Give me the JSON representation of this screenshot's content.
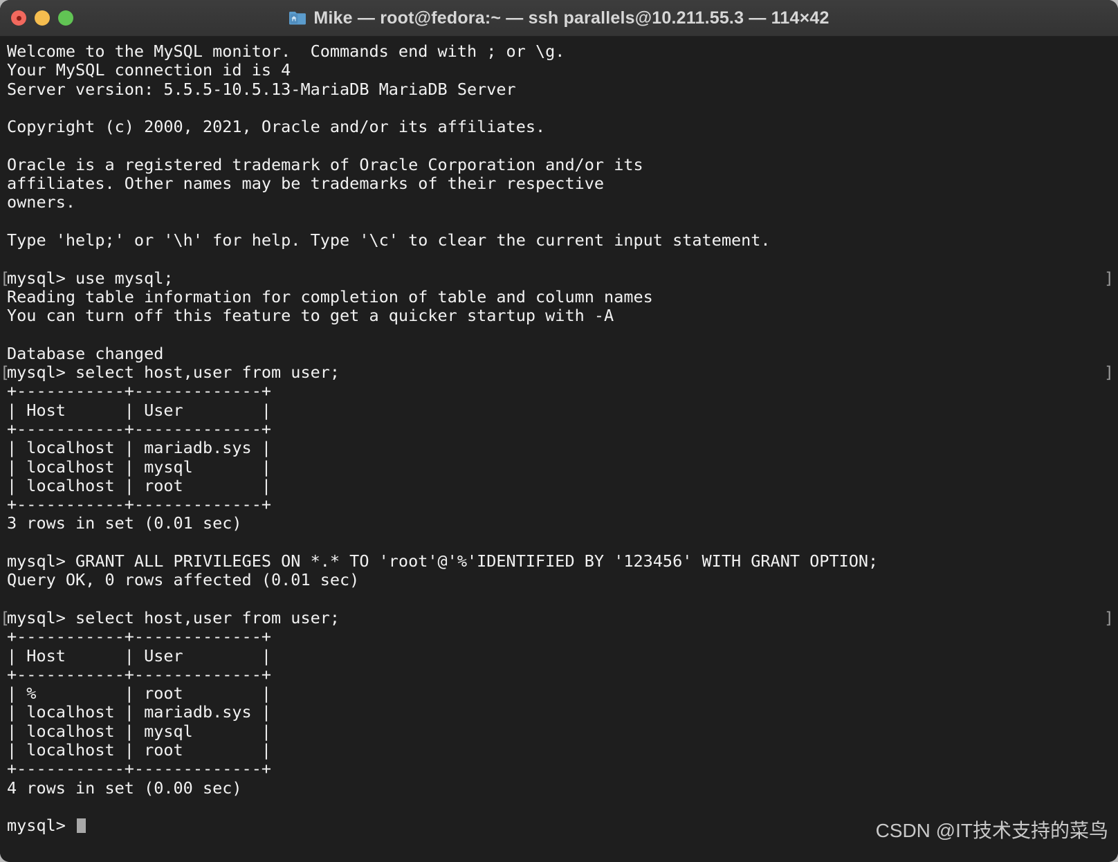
{
  "window": {
    "title": "Mike — root@fedora:~ — ssh parallels@10.211.55.3 — 114×42",
    "icon": "home-folder-icon",
    "titlebar_bg": "#383838",
    "terminal_bg": "#1e1e1e",
    "text_color": "#f2f2f2",
    "traffic_lights": [
      {
        "name": "close",
        "color": "#f2695e",
        "label": "Close"
      },
      {
        "name": "minimize",
        "color": "#f5bd4f",
        "label": "Minimize"
      },
      {
        "name": "zoom",
        "color": "#61c454",
        "label": "Zoom"
      }
    ]
  },
  "terminal": {
    "prompt": "mysql> ",
    "cursor": "block",
    "lines": [
      {
        "text": "Welcome to the MySQL monitor.  Commands end with ; or \\g."
      },
      {
        "text": "Your MySQL connection id is 4"
      },
      {
        "text": "Server version: 5.5.5-10.5.13-MariaDB MariaDB Server"
      },
      {
        "text": ""
      },
      {
        "text": "Copyright (c) 2000, 2021, Oracle and/or its affiliates."
      },
      {
        "text": ""
      },
      {
        "text": "Oracle is a registered trademark of Oracle Corporation and/or its"
      },
      {
        "text": "affiliates. Other names may be trademarks of their respective"
      },
      {
        "text": "owners."
      },
      {
        "text": ""
      },
      {
        "text": "Type 'help;' or '\\h' for help. Type '\\c' to clear the current input statement."
      },
      {
        "text": ""
      },
      {
        "text": "mysql> use mysql;",
        "mark_left": "[",
        "mark_right": "]"
      },
      {
        "text": "Reading table information for completion of table and column names"
      },
      {
        "text": "You can turn off this feature to get a quicker startup with -A"
      },
      {
        "text": ""
      },
      {
        "text": "Database changed"
      },
      {
        "text": "mysql> select host,user from user;",
        "mark_left": "[",
        "mark_right": "]"
      },
      {
        "text": "+-----------+-------------+"
      },
      {
        "text": "| Host      | User        |"
      },
      {
        "text": "+-----------+-------------+"
      },
      {
        "text": "| localhost | mariadb.sys |"
      },
      {
        "text": "| localhost | mysql       |"
      },
      {
        "text": "| localhost | root        |"
      },
      {
        "text": "+-----------+-------------+"
      },
      {
        "text": "3 rows in set (0.01 sec)"
      },
      {
        "text": ""
      },
      {
        "text": "mysql> GRANT ALL PRIVILEGES ON *.* TO 'root'@'%'IDENTIFIED BY '123456' WITH GRANT OPTION;"
      },
      {
        "text": "Query OK, 0 rows affected (0.01 sec)"
      },
      {
        "text": ""
      },
      {
        "text": "mysql> select host,user from user;",
        "mark_left": "[",
        "mark_right": "]"
      },
      {
        "text": "+-----------+-------------+"
      },
      {
        "text": "| Host      | User        |"
      },
      {
        "text": "+-----------+-------------+"
      },
      {
        "text": "| %         | root        |"
      },
      {
        "text": "| localhost | mariadb.sys |"
      },
      {
        "text": "| localhost | mysql       |"
      },
      {
        "text": "| localhost | root        |"
      },
      {
        "text": "+-----------+-------------+"
      },
      {
        "text": "4 rows in set (0.00 sec)"
      },
      {
        "text": ""
      },
      {
        "text": "mysql> ",
        "cursor": true
      }
    ]
  },
  "watermark": {
    "text": "CSDN @IT技术支持的菜鸟"
  }
}
